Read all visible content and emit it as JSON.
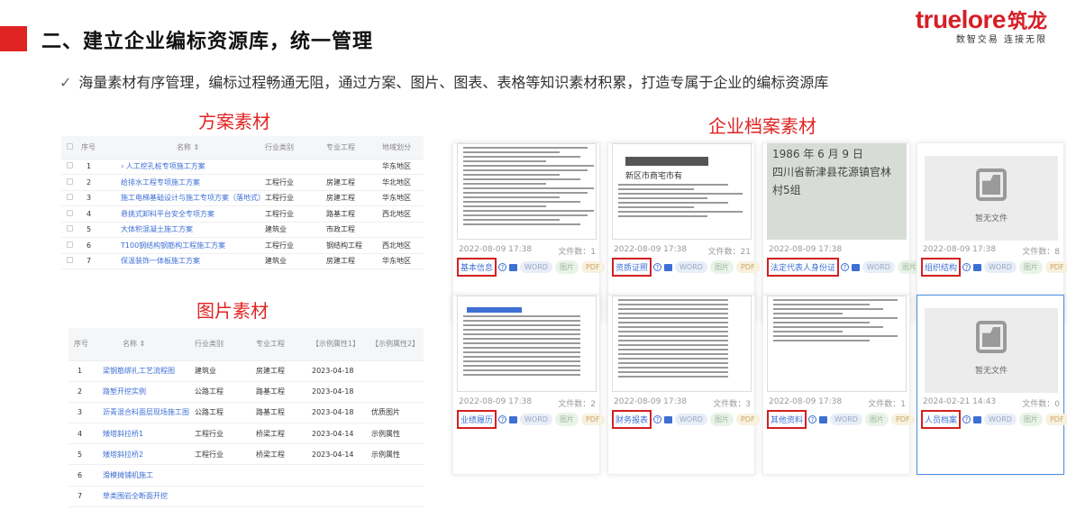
{
  "header": {
    "title": "二、建立企业编标资源库，统一管理",
    "logo_main": "truelore",
    "logo_cn": "筑龙",
    "logo_sub": "数智交易 连接无限",
    "bullet": "海量素材有序管理，编标过程畅通无阻，通过方案、图片、图表、表格等知识素材积累，打造专属于企业的编标资源库",
    "check": "✓"
  },
  "labels": {
    "scheme": "方案素材",
    "image": "图片素材",
    "enterprise": "企业档案素材"
  },
  "scheme_table": {
    "headers": [
      "序号",
      "名称 ⇕",
      "行业类别",
      "专业工程",
      "地域划分"
    ],
    "rows": [
      {
        "no": "1",
        "name": "› 人工挖孔桩专项施工方案",
        "industry": "",
        "major": "",
        "region": "华东地区"
      },
      {
        "no": "2",
        "name": "给排水工程专项施工方案",
        "industry": "工程行业",
        "major": "房建工程",
        "region": "华北地区"
      },
      {
        "no": "3",
        "name": "施工电梯基础设计与施工专项方案（落地式）",
        "industry": "工程行业",
        "major": "房建工程",
        "region": "华东地区"
      },
      {
        "no": "4",
        "name": "悬挑式卸料平台安全专项方案",
        "industry": "工程行业",
        "major": "路基工程",
        "region": "西北地区"
      },
      {
        "no": "5",
        "name": "大体积混凝土施工方案",
        "industry": "建筑业",
        "major": "市政工程",
        "region": ""
      },
      {
        "no": "6",
        "name": "T100钢结构钢筋构工程施工方案",
        "industry": "工程行业",
        "major": "钢结构工程",
        "region": "西北地区"
      },
      {
        "no": "7",
        "name": "保温装饰一体板施工方案",
        "industry": "建筑业",
        "major": "房建工程",
        "region": "华东地区"
      }
    ]
  },
  "image_table": {
    "headers": [
      "序号",
      "名称 ⇕",
      "行业类别",
      "专业工程",
      "【示例属性1】",
      "【示例属性2】"
    ],
    "rows": [
      {
        "no": "1",
        "name": "梁钢筋绑扎工艺流程图",
        "industry": "建筑业",
        "major": "房建工程",
        "a1": "2023-04-18",
        "a2": ""
      },
      {
        "no": "2",
        "name": "路堑开挖实例",
        "industry": "公路工程",
        "major": "路基工程",
        "a1": "2023-04-18",
        "a2": ""
      },
      {
        "no": "3",
        "name": "沥青混合料面层现场施工图",
        "industry": "公路工程",
        "major": "路基工程",
        "a1": "2023-04-18",
        "a2": "优质图片"
      },
      {
        "no": "4",
        "name": "矮塔斜拉桥1",
        "industry": "工程行业",
        "major": "桥梁工程",
        "a1": "2023-04-14",
        "a2": "示例属性"
      },
      {
        "no": "5",
        "name": "矮塔斜拉桥2",
        "industry": "工程行业",
        "major": "桥梁工程",
        "a1": "2023-04-14",
        "a2": "示例属性"
      },
      {
        "no": "6",
        "name": "滑模摊铺机施工",
        "industry": "",
        "major": "",
        "a1": "",
        "a2": ""
      },
      {
        "no": "7",
        "name": "草类围岩全断面开挖",
        "industry": "",
        "major": "",
        "a1": "",
        "a2": ""
      }
    ]
  },
  "cards": [
    {
      "title": "基本信息",
      "date": "2022-08-09 17:38",
      "count": "文件数：1",
      "preview": "doc"
    },
    {
      "title": "资质证照",
      "date": "2022-08-09 17:38",
      "count": "文件数：21",
      "preview": "license"
    },
    {
      "title": "法定代表人身份证",
      "date": "2022-08-09 17:38",
      "count": "",
      "preview": "idcard"
    },
    {
      "title": "组织结构",
      "date": "2022-08-09 17:38",
      "count": "文件数：8",
      "preview": "empty"
    },
    {
      "title": "业绩履历",
      "date": "2022-08-09 17:38",
      "count": "文件数：2",
      "preview": "screen"
    },
    {
      "title": "财务报表",
      "date": "2022-08-09 17:38",
      "count": "文件数：3",
      "preview": "table"
    },
    {
      "title": "其他资料",
      "date": "2022-08-09 17:38",
      "count": "文件数：1",
      "preview": "text"
    },
    {
      "title": "人员档案",
      "date": "2024-02-21 14:43",
      "count": "文件数：0",
      "preview": "empty"
    }
  ],
  "card_pills": {
    "word": "WORD",
    "img": "图片",
    "pdf": "PDF",
    "q": "?"
  },
  "empty_text": "暂无文件",
  "license_text": {
    "line1": "经营范围",
    "line2": "新区市商宅市有",
    "line3": "1986 年 6 月 9 日",
    "line4": "四川省新津县花源镇官林",
    "line5": "村5组"
  },
  "colors": {
    "accent_red": "#e02424",
    "link_blue": "#3d6fd4"
  }
}
